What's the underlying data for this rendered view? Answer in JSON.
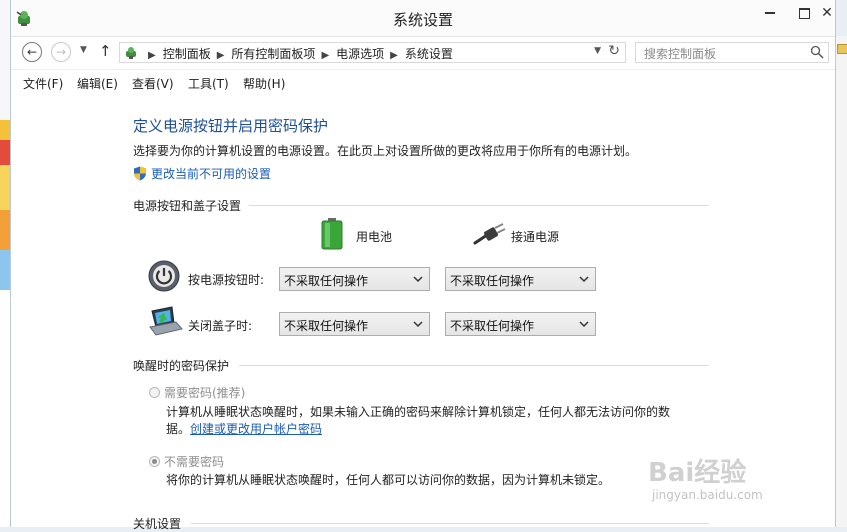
{
  "window": {
    "title": "系统设置"
  },
  "address_bar": {
    "back_icon": "back-arrow-icon",
    "forward_icon": "forward-arrow-icon",
    "breadcrumbs": [
      "控制面板",
      "所有控制面板项",
      "电源选项",
      "系统设置"
    ],
    "search_placeholder": "搜索控制面板"
  },
  "menu": {
    "file": "文件(F)",
    "edit": "编辑(E)",
    "view": "查看(V)",
    "tools": "工具(T)",
    "help": "帮助(H)"
  },
  "page": {
    "heading": "定义电源按钮并启用密码保护",
    "description": "选择要为你的计算机设置的电源设置。在此页上对设置所做的更改将应用于你所有的电源计划。",
    "change_link": "更改当前不可用的设置"
  },
  "power_section": {
    "title": "电源按钮和盖子设置",
    "battery_label": "用电池",
    "plugged_label": "接通电源",
    "rows": [
      {
        "label": "按电源按钮时:",
        "battery_value": "不采取任何操作",
        "plugged_value": "不采取任何操作"
      },
      {
        "label": "关闭盖子时:",
        "battery_value": "不采取任何操作",
        "plugged_value": "不采取任何操作"
      }
    ]
  },
  "password_section": {
    "title": "唤醒时的密码保护",
    "require_option": "需要密码(推荐)",
    "require_desc_1": "计算机从睡眠状态唤醒时，如果未输入正确的密码来解除计算机锁定，任何人都无法访问你的数",
    "require_desc_2": "据。",
    "require_link": "创建或更改用户帐户密码",
    "none_option": "不需要密码",
    "none_desc": "将你的计算机从睡眠状态唤醒时，任何人都可以访问你的数据，因为计算机未锁定。",
    "selected": "none"
  },
  "shutdown_section": {
    "title": "关机设置"
  },
  "watermark": {
    "brand": "Bai经验",
    "url": "jingyan.baidu.com"
  },
  "colors": {
    "heading": "#1f4e9a",
    "link": "#1a5cb8",
    "disabled_text": "#8e8e8e"
  }
}
